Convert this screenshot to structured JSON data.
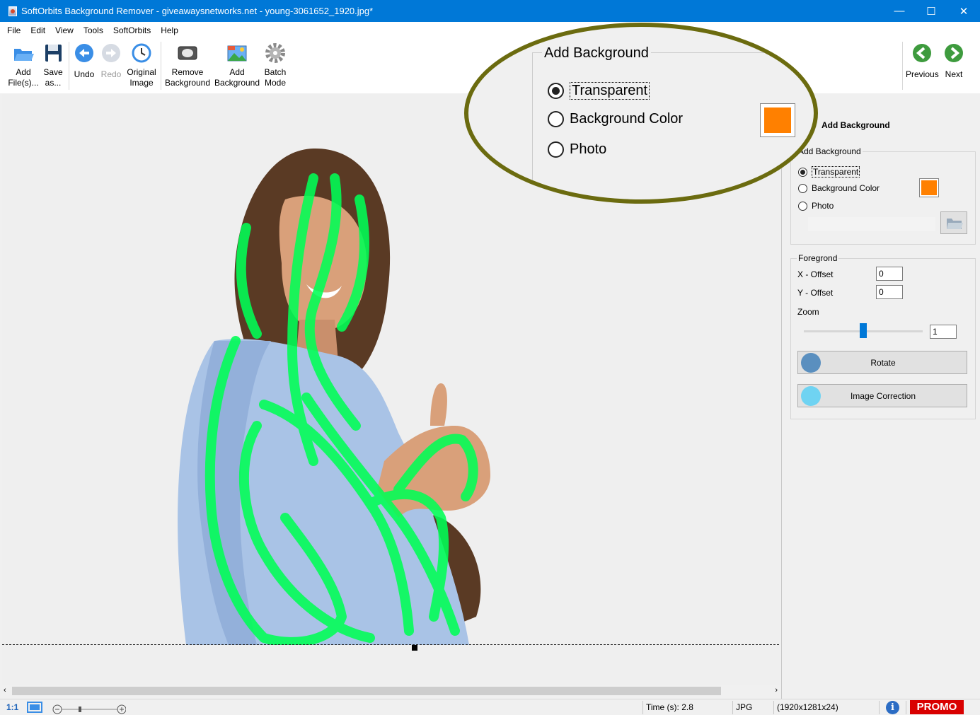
{
  "window": {
    "title": "SoftOrbits Background Remover - giveawaysnetworks.net - young-3061652_1920.jpg*",
    "minimize": "—",
    "maximize": "☐",
    "close": "✕"
  },
  "menu": [
    "File",
    "Edit",
    "View",
    "Tools",
    "SoftOrbits",
    "Help"
  ],
  "toolbar": {
    "add_files": {
      "line1": "Add",
      "line2": "File(s)..."
    },
    "save_as": {
      "line1": "Save",
      "line2": "as..."
    },
    "undo": "Undo",
    "redo": "Redo",
    "original_image": {
      "line1": "Original",
      "line2": "Image"
    },
    "remove_background": {
      "line1": "Remove",
      "line2": "Background"
    },
    "add_background": {
      "line1": "Add",
      "line2": "Background"
    },
    "batch_mode": {
      "line1": "Batch",
      "line2": "Mode"
    },
    "previous": "Previous",
    "next": "Next"
  },
  "callout": {
    "legend": "Add Background",
    "transparent": "Transparent",
    "background_color": "Background Color",
    "photo": "Photo"
  },
  "panel": {
    "close": "x",
    "heading": "Add Background",
    "add_background": {
      "legend": "Add Background",
      "transparent": "Transparent",
      "background_color": "Background Color",
      "photo": "Photo",
      "selected": "Transparent"
    },
    "foreground": {
      "legend": "Foregrond",
      "x_offset_label": "X - Offset",
      "x_offset": "0",
      "y_offset_label": "Y - Offset",
      "y_offset": "0",
      "zoom_label": "Zoom",
      "zoom": "1"
    },
    "rotate": "Rotate",
    "image_correction": "Image Correction"
  },
  "colors": {
    "accent": "#0078d7",
    "swatch": "#ff8000",
    "brush": "#00ff55",
    "callout_ring": "#6b6b0f",
    "promo": "#d90000"
  },
  "status": {
    "zoom_ratio": "1:1",
    "time": "Time (s): 2.8",
    "format": "JPG",
    "dimensions": "(1920x1281x24)",
    "promo": "PROMO",
    "info": "i"
  }
}
